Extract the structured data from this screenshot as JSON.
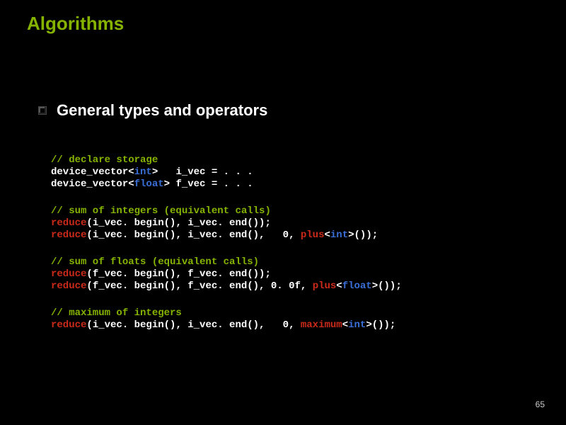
{
  "title": "Algorithms",
  "subtitle": "General types and operators",
  "page_number": "65",
  "code": {
    "b1": {
      "c1": "// declare storage",
      "l2a": "device_vector",
      "l2b": "<",
      "l2c": "int",
      "l2d": ">   i_vec = . . .",
      "l3a": "device_vector",
      "l3b": "<",
      "l3c": "float",
      "l3d": "> f_vec = . . ."
    },
    "b2": {
      "c1": "// sum of integers (equivalent calls)",
      "l2a": "reduce",
      "l2b": "(i_vec. begin(), i_vec. end());",
      "l3a": "reduce",
      "l3b": "(i_vec. begin(), i_vec. end(),   0, ",
      "l3c": "plus",
      "l3d": "<",
      "l3e": "int",
      "l3f": ">());"
    },
    "b3": {
      "c1": "// sum of floats (equivalent calls)",
      "l2a": "reduce",
      "l2b": "(f_vec. begin(), f_vec. end());",
      "l3a": "reduce",
      "l3b": "(f_vec. begin(), f_vec. end(), 0. 0f, ",
      "l3c": "plus",
      "l3d": "<",
      "l3e": "float",
      "l3f": ">());"
    },
    "b4": {
      "c1": "// maximum of integers",
      "l2a": "reduce",
      "l2b": "(i_vec. begin(), i_vec. end(),   0, ",
      "l2c": "maximum",
      "l2d": "<",
      "l2e": "int",
      "l2f": ">());"
    }
  }
}
